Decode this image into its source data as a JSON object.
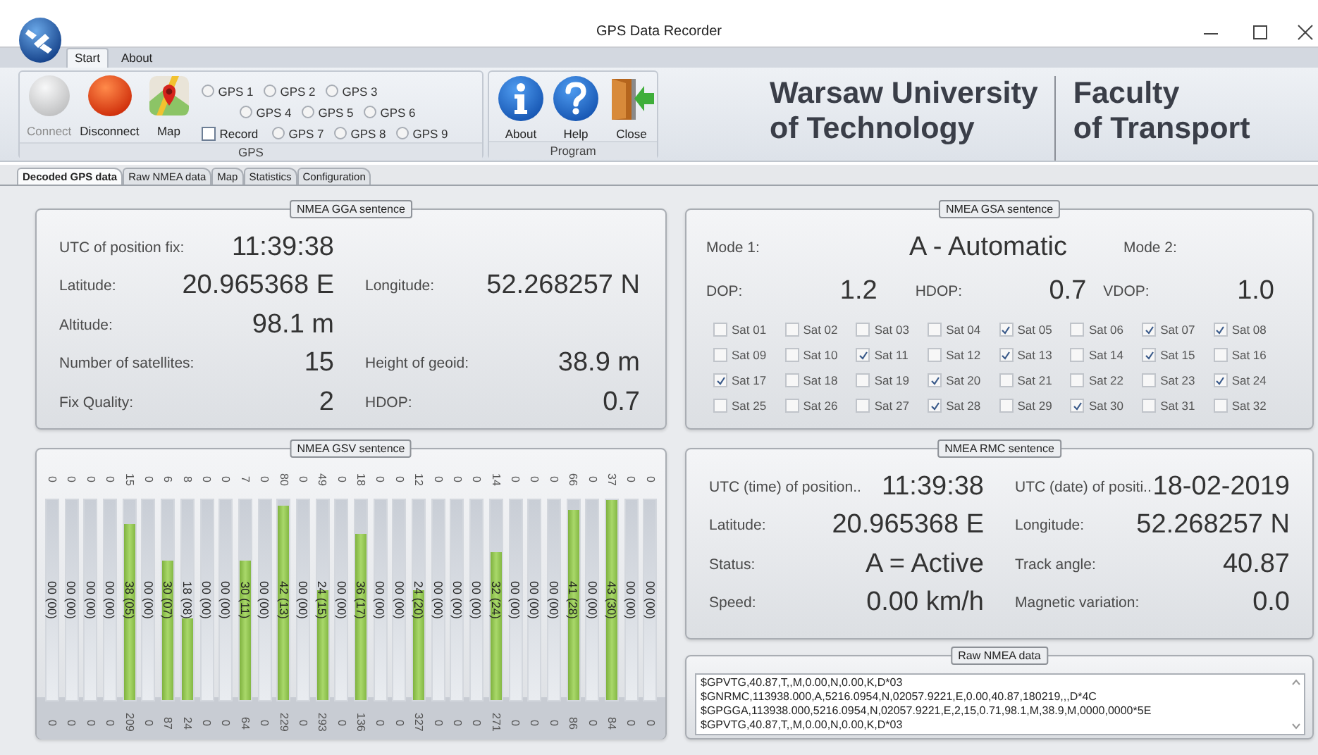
{
  "window": {
    "title": "GPS Data Recorder"
  },
  "ribbon_tabs": [
    {
      "label": "Start",
      "selected": true
    },
    {
      "label": "About",
      "selected": false
    }
  ],
  "gps_group": {
    "label": "GPS",
    "buttons": [
      {
        "kind": "connect",
        "label": "Connect",
        "disabled": true
      },
      {
        "kind": "disconnect",
        "label": "Disconnect",
        "disabled": false
      },
      {
        "kind": "map",
        "label": "Map",
        "disabled": false
      }
    ],
    "receiver_rows": [
      [
        {
          "label": "GPS 1",
          "selected": false
        },
        {
          "label": "GPS 2",
          "selected": false
        },
        {
          "label": "GPS 3",
          "selected": false
        }
      ],
      [
        {
          "label": "GPS 4",
          "selected": false
        },
        {
          "label": "GPS 5",
          "selected": false
        },
        {
          "label": "GPS 6",
          "selected": false
        }
      ],
      [
        {
          "label": "GPS 7",
          "selected": false
        },
        {
          "label": "GPS 8",
          "selected": false
        },
        {
          "label": "GPS 9",
          "selected": false
        }
      ]
    ],
    "record": {
      "label": "Record",
      "checked": false
    }
  },
  "program_group": {
    "label": "Program",
    "buttons": [
      {
        "kind": "about",
        "label": "About"
      },
      {
        "kind": "help",
        "label": "Help"
      },
      {
        "kind": "close",
        "label": "Close"
      }
    ]
  },
  "logo": {
    "left": [
      "Warsaw University",
      "of Technology"
    ],
    "right": [
      "Faculty",
      "of Transport"
    ]
  },
  "doc_tabs": [
    {
      "label": "Decoded GPS data",
      "selected": true
    },
    {
      "label": "Raw NMEA data",
      "selected": false
    },
    {
      "label": "Map",
      "selected": false
    },
    {
      "label": "Statistics",
      "selected": false
    },
    {
      "label": "Configuration",
      "selected": false
    }
  ],
  "gga": {
    "title": "NMEA GGA sentence",
    "rows": [
      {
        "left": {
          "label": "UTC of position fix:",
          "value": "11:39:38"
        }
      },
      {
        "left": {
          "label": "Latitude:",
          "value": "20.965368 E"
        },
        "right": {
          "label": "Longitude:",
          "value": "52.268257 N"
        }
      },
      {
        "left": {
          "label": "Altitude:",
          "value": "98.1 m"
        }
      },
      {
        "left": {
          "label": "Number of satellites:",
          "value": "15"
        },
        "right": {
          "label": "Height of geoid:",
          "value": "38.9 m"
        }
      },
      {
        "left": {
          "label": "Fix Quality:",
          "value": "2"
        },
        "right": {
          "label": "HDOP:",
          "value": "0.7"
        }
      }
    ]
  },
  "gsa": {
    "title": "NMEA GSA sentence",
    "mode1_label": "Mode 1:",
    "mode1_value": "A - Automatic",
    "mode2_label": "Mode 2:",
    "dop": [
      {
        "label": "DOP:",
        "value": "1.2"
      },
      {
        "label": "HDOP:",
        "value": "0.7"
      },
      {
        "label": "VDOP:",
        "value": "1.0"
      }
    ],
    "satellites": [
      {
        "label": "Sat 01",
        "checked": false
      },
      {
        "label": "Sat 02",
        "checked": false
      },
      {
        "label": "Sat 03",
        "checked": false
      },
      {
        "label": "Sat 04",
        "checked": false
      },
      {
        "label": "Sat 05",
        "checked": true
      },
      {
        "label": "Sat 06",
        "checked": false
      },
      {
        "label": "Sat 07",
        "checked": true
      },
      {
        "label": "Sat 08",
        "checked": true
      },
      {
        "label": "Sat 09",
        "checked": false
      },
      {
        "label": "Sat 10",
        "checked": false
      },
      {
        "label": "Sat 11",
        "checked": true
      },
      {
        "label": "Sat 12",
        "checked": false
      },
      {
        "label": "Sat 13",
        "checked": true
      },
      {
        "label": "Sat 14",
        "checked": false
      },
      {
        "label": "Sat 15",
        "checked": true
      },
      {
        "label": "Sat 16",
        "checked": false
      },
      {
        "label": "Sat 17",
        "checked": true
      },
      {
        "label": "Sat 18",
        "checked": false
      },
      {
        "label": "Sat 19",
        "checked": false
      },
      {
        "label": "Sat 20",
        "checked": true
      },
      {
        "label": "Sat 21",
        "checked": false
      },
      {
        "label": "Sat 22",
        "checked": false
      },
      {
        "label": "Sat 23",
        "checked": false
      },
      {
        "label": "Sat 24",
        "checked": true
      },
      {
        "label": "Sat 25",
        "checked": false
      },
      {
        "label": "Sat 26",
        "checked": false
      },
      {
        "label": "Sat 27",
        "checked": false
      },
      {
        "label": "Sat 28",
        "checked": true
      },
      {
        "label": "Sat 29",
        "checked": false
      },
      {
        "label": "Sat 30",
        "checked": true
      },
      {
        "label": "Sat 31",
        "checked": false
      },
      {
        "label": "Sat 32",
        "checked": false
      }
    ]
  },
  "gsv": {
    "title": "NMEA GSV sentence",
    "channels": [
      {
        "elevation": "0",
        "label": "00 (00)",
        "level": 0,
        "azimuth": "0"
      },
      {
        "elevation": "0",
        "label": "00 (00)",
        "level": 0,
        "azimuth": "0"
      },
      {
        "elevation": "0",
        "label": "00 (00)",
        "level": 0,
        "azimuth": "0"
      },
      {
        "elevation": "0",
        "label": "00 (00)",
        "level": 0,
        "azimuth": "0"
      },
      {
        "elevation": "15",
        "label": "38 (05)",
        "level": 0.88,
        "azimuth": "209"
      },
      {
        "elevation": "0",
        "label": "00 (00)",
        "level": 0,
        "azimuth": "0"
      },
      {
        "elevation": "6",
        "label": "30 (07)",
        "level": 0.7,
        "azimuth": "87"
      },
      {
        "elevation": "8",
        "label": "18 (08)",
        "level": 0.41,
        "azimuth": "24"
      },
      {
        "elevation": "0",
        "label": "00 (00)",
        "level": 0,
        "azimuth": "0"
      },
      {
        "elevation": "0",
        "label": "00 (00)",
        "level": 0,
        "azimuth": "0"
      },
      {
        "elevation": "7",
        "label": "30 (11)",
        "level": 0.7,
        "azimuth": "64"
      },
      {
        "elevation": "0",
        "label": "00 (00)",
        "level": 0,
        "azimuth": "0"
      },
      {
        "elevation": "80",
        "label": "42 (13)",
        "level": 0.97,
        "azimuth": "229"
      },
      {
        "elevation": "0",
        "label": "00 (00)",
        "level": 0,
        "azimuth": "0"
      },
      {
        "elevation": "49",
        "label": "24 (15)",
        "level": 0.55,
        "azimuth": "293"
      },
      {
        "elevation": "0",
        "label": "00 (00)",
        "level": 0,
        "azimuth": "0"
      },
      {
        "elevation": "18",
        "label": "36 (17)",
        "level": 0.83,
        "azimuth": "136"
      },
      {
        "elevation": "0",
        "label": "00 (00)",
        "level": 0,
        "azimuth": "0"
      },
      {
        "elevation": "0",
        "label": "00 (00)",
        "level": 0,
        "azimuth": "0"
      },
      {
        "elevation": "12",
        "label": "24 (20)",
        "level": 0.55,
        "azimuth": "327"
      },
      {
        "elevation": "0",
        "label": "00 (00)",
        "level": 0,
        "azimuth": "0"
      },
      {
        "elevation": "0",
        "label": "00 (00)",
        "level": 0,
        "azimuth": "0"
      },
      {
        "elevation": "0",
        "label": "00 (00)",
        "level": 0,
        "azimuth": "0"
      },
      {
        "elevation": "14",
        "label": "32 (24)",
        "level": 0.74,
        "azimuth": "271"
      },
      {
        "elevation": "0",
        "label": "00 (00)",
        "level": 0,
        "azimuth": "0"
      },
      {
        "elevation": "0",
        "label": "00 (00)",
        "level": 0,
        "azimuth": "0"
      },
      {
        "elevation": "0",
        "label": "00 (00)",
        "level": 0,
        "azimuth": "0"
      },
      {
        "elevation": "66",
        "label": "41 (28)",
        "level": 0.95,
        "azimuth": "86"
      },
      {
        "elevation": "0",
        "label": "00 (00)",
        "level": 0,
        "azimuth": "0"
      },
      {
        "elevation": "37",
        "label": "43 (30)",
        "level": 1,
        "azimuth": "84"
      },
      {
        "elevation": "0",
        "label": "00 (00)",
        "level": 0,
        "azimuth": "0"
      },
      {
        "elevation": "0",
        "label": "00 (00)",
        "level": 0,
        "azimuth": "0"
      }
    ]
  },
  "rmc": {
    "title": "NMEA RMC sentence",
    "rows": [
      {
        "left": {
          "label": "UTC (time) of position..",
          "value": "11:39:38"
        },
        "right": {
          "label": "UTC (date) of positi..",
          "value": "18-02-2019"
        }
      },
      {
        "left": {
          "label": "Latitude:",
          "value": "20.965368 E"
        },
        "right": {
          "label": "Longitude:",
          "value": "52.268257 N"
        }
      },
      {
        "left": {
          "label": "Status:",
          "value": "A = Active"
        },
        "right": {
          "label": "Track angle:",
          "value": "40.87"
        }
      },
      {
        "left": {
          "label": "Speed:",
          "value": "0.00 km/h"
        },
        "right": {
          "label": "Magnetic variation:",
          "value": "0.0"
        }
      }
    ]
  },
  "raw": {
    "title": "Raw NMEA data",
    "lines": [
      "$GPVTG,40.87,T,,M,0.00,N,0.00,K,D*03",
      "$GNRMC,113938.000,A,5216.0954,N,02057.9221,E,0.00,40.87,180219,,,D*4C",
      "$GPGGA,113938.000,5216.0954,N,02057.9221,E,2,15,0.71,98.1,M,38.9,M,0000,0000*5E",
      "$GPVTG,40.87,T,,M,0.00,N,0.00,K,D*03"
    ]
  }
}
